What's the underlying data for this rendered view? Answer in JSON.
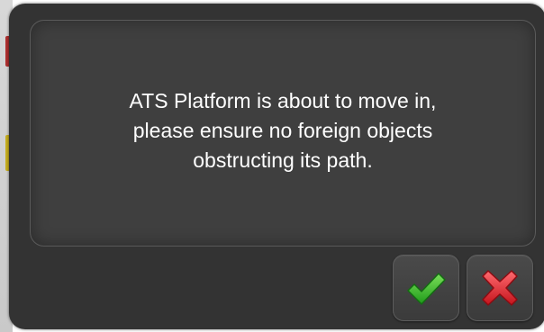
{
  "dialog": {
    "message": "ATS Platform is about to move in,\nplease ensure no foreign objects\nobstructing its path.",
    "confirm_icon": "checkmark-icon",
    "cancel_icon": "x-icon"
  },
  "colors": {
    "dialog_bg": "#333333",
    "panel_bg": "#3f3f3f",
    "text": "#ffffff",
    "confirm": "#3bbf2b",
    "cancel": "#e8323a"
  }
}
